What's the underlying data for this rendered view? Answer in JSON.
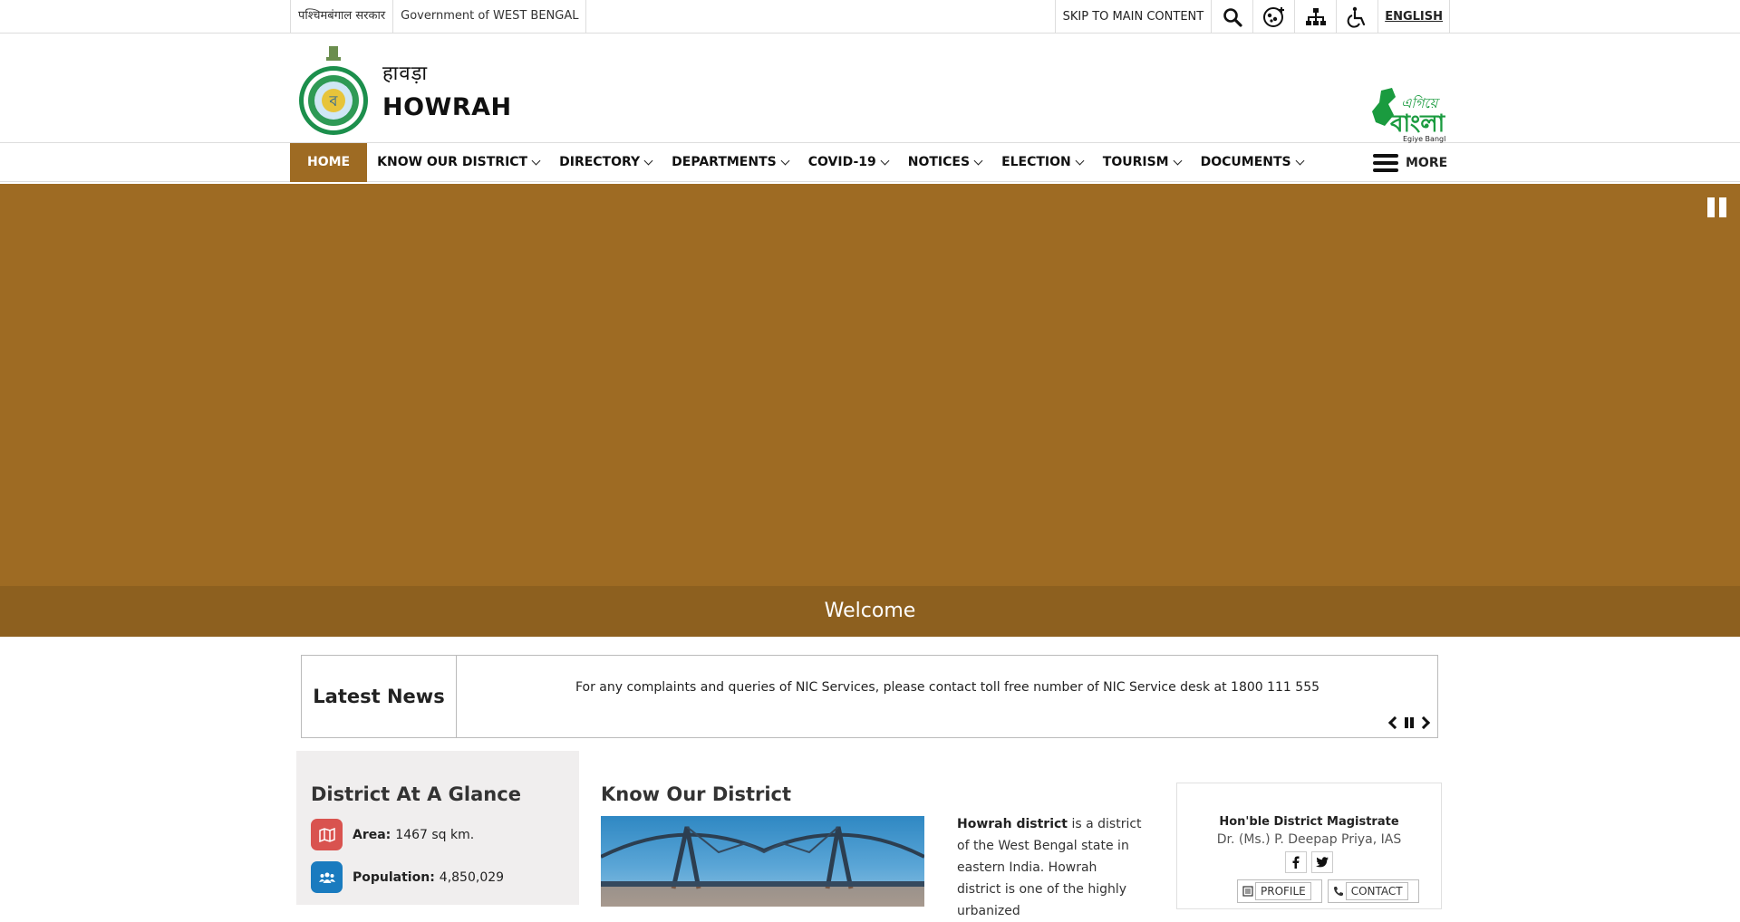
{
  "topbar": {
    "gov_native": "पश्चिमबंगाल सरकार",
    "gov_english": "Government of WEST BENGAL",
    "skip_label": "SKIP TO MAIN CONTENT",
    "language": "ENGLISH",
    "icons": [
      "search-icon",
      "social-icon",
      "sitemap-icon",
      "accessibility-icon"
    ]
  },
  "header": {
    "title_native": "हावड़ा",
    "title": "HOWRAH",
    "right_logo_text": "Egiye Bangla"
  },
  "nav": {
    "items": [
      {
        "label": "HOME",
        "active": true
      },
      {
        "label": "KNOW OUR DISTRICT"
      },
      {
        "label": "DIRECTORY"
      },
      {
        "label": "DEPARTMENTS"
      },
      {
        "label": "COVID-19"
      },
      {
        "label": "NOTICES"
      },
      {
        "label": "ELECTION"
      },
      {
        "label": "TOURISM"
      },
      {
        "label": "DOCUMENTS"
      }
    ],
    "more": "MORE"
  },
  "hero": {
    "caption": "Welcome",
    "bg_color": "#9e6b23"
  },
  "news": {
    "title": "Latest News",
    "item": "For any complaints and queries of NIC Services, please contact toll free number of NIC Service desk at 1800 111 555"
  },
  "glance": {
    "title": "District At A Glance",
    "area_label": "Area:",
    "area_value": "1467 sq km.",
    "population_label": "Population:",
    "population_value": "4,850,029",
    "area_icon_color": "#d9534f",
    "population_icon_color": "#1a7bbf"
  },
  "know_district": {
    "title": "Know Our District",
    "lead_bold": "Howrah district",
    "lead_text": " is a district of the West Bengal state in eastern India. Howrah district is one of the highly urbanized"
  },
  "dm": {
    "title": "Hon'ble District Magistrate",
    "name": "Dr. (Ms.) P. Deepap Priya, IAS",
    "profile": "PROFILE",
    "contact": "CONTACT"
  }
}
